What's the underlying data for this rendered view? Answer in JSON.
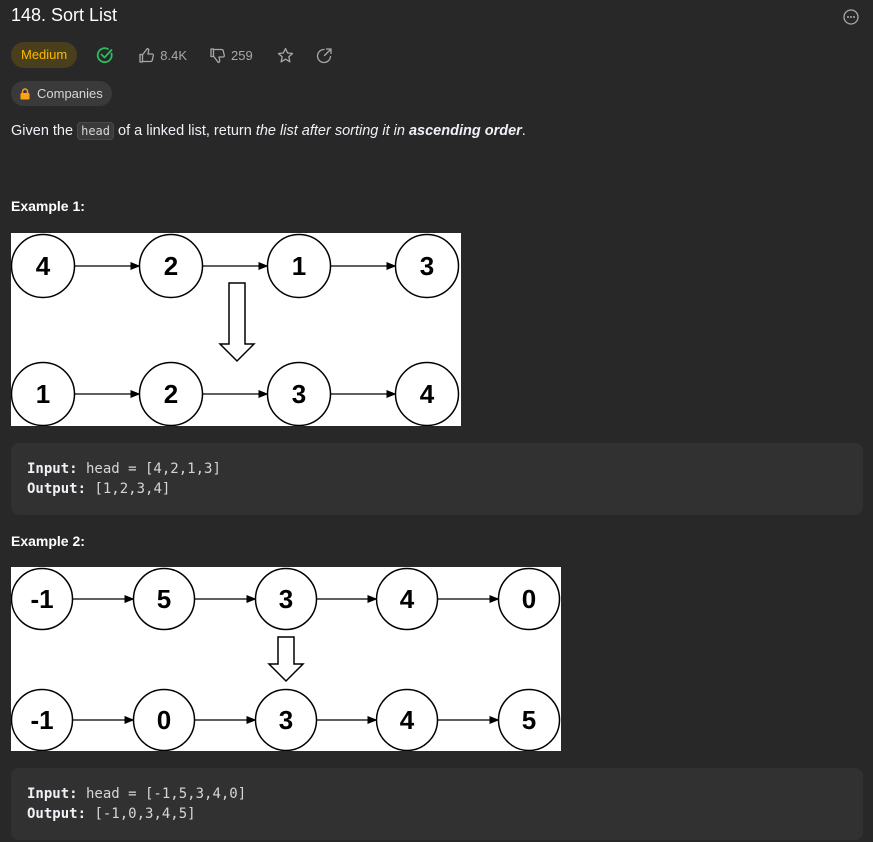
{
  "problem": {
    "title": "148. Sort List",
    "difficulty": "Medium",
    "likes": "8.4K",
    "dislikes": "259",
    "companies_label": "Companies"
  },
  "description": {
    "p1": "Given the ",
    "code": "head",
    "p2": " of a linked list, return ",
    "p3": "the list after sorting it in ",
    "p4": "ascending order",
    "p5": "."
  },
  "examples": [
    {
      "title": "Example 1:",
      "input_label": "Input:",
      "input_value": " head = [4,2,1,3]",
      "output_label": "Output:",
      "output_value": " [1,2,3,4]",
      "diagram": {
        "top": [
          "4",
          "2",
          "1",
          "3"
        ],
        "bottom": [
          "1",
          "2",
          "3",
          "4"
        ]
      }
    },
    {
      "title": "Example 2:",
      "input_label": "Input:",
      "input_value": " head = [-1,5,3,4,0]",
      "output_label": "Output:",
      "output_value": " [-1,0,3,4,5]",
      "diagram": {
        "top": [
          "-1",
          "5",
          "3",
          "4",
          "0"
        ],
        "bottom": [
          "-1",
          "0",
          "3",
          "4",
          "5"
        ]
      }
    }
  ],
  "icons": {
    "more": "more-icon",
    "solved": "check-circle-icon",
    "like": "thumbs-up-icon",
    "dislike": "thumbs-down-icon",
    "favorite": "star-icon",
    "share": "share-icon",
    "lock": "lock-icon"
  },
  "colors": {
    "background": "#282828",
    "medium": "#ffb800",
    "solved": "#2cbb5d"
  }
}
